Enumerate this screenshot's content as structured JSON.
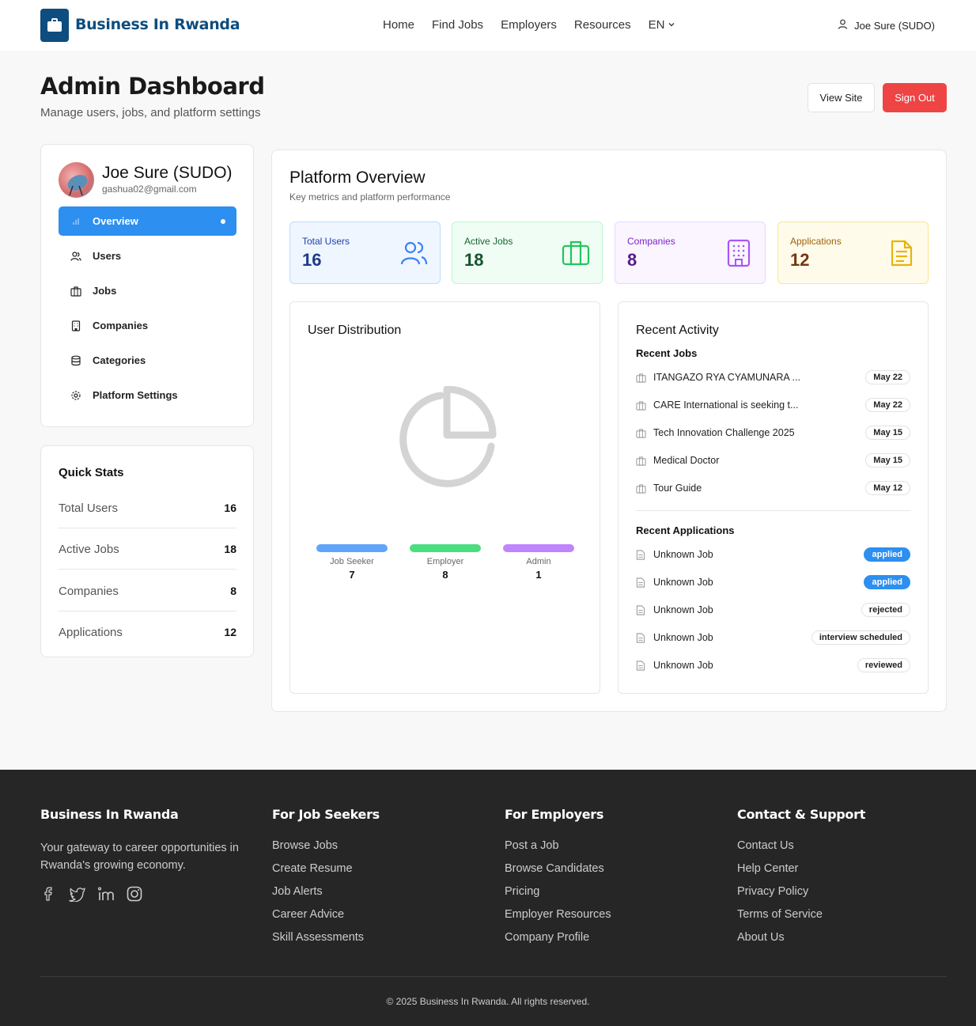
{
  "header": {
    "brand": "Business In Rwanda",
    "nav": [
      "Home",
      "Find Jobs",
      "Employers",
      "Resources"
    ],
    "language": "EN",
    "user": "Joe Sure (SUDO)"
  },
  "page": {
    "title": "Admin Dashboard",
    "subtitle": "Manage users, jobs, and platform settings",
    "view_site": "View Site",
    "sign_out": "Sign Out"
  },
  "profile": {
    "name": "Joe Sure (SUDO)",
    "email": "gashua02@gmail.com"
  },
  "menu": [
    {
      "label": "Overview",
      "icon": "bar-chart-icon",
      "active": true
    },
    {
      "label": "Users",
      "icon": "users-icon"
    },
    {
      "label": "Jobs",
      "icon": "briefcase-icon"
    },
    {
      "label": "Companies",
      "icon": "building-icon"
    },
    {
      "label": "Categories",
      "icon": "database-icon"
    },
    {
      "label": "Platform Settings",
      "icon": "gear-icon"
    }
  ],
  "quick_stats": {
    "title": "Quick Stats",
    "rows": [
      {
        "label": "Total Users",
        "value": "16"
      },
      {
        "label": "Active Jobs",
        "value": "18"
      },
      {
        "label": "Companies",
        "value": "8"
      },
      {
        "label": "Applications",
        "value": "12"
      }
    ]
  },
  "overview": {
    "title": "Platform Overview",
    "subtitle": "Key metrics and platform performance",
    "stats": [
      {
        "label": "Total Users",
        "value": "16",
        "icon": "users-icon",
        "color": "#1e40af"
      },
      {
        "label": "Active Jobs",
        "value": "18",
        "icon": "briefcase-icon",
        "color": "#166534"
      },
      {
        "label": "Companies",
        "value": "8",
        "icon": "building-icon",
        "color": "#6b21a8"
      },
      {
        "label": "Applications",
        "value": "12",
        "icon": "document-icon",
        "color": "#92400e"
      }
    ]
  },
  "distribution": {
    "title": "User Distribution",
    "legend": [
      {
        "name": "Job Seeker",
        "value": "7",
        "color": "#60a5fa"
      },
      {
        "name": "Employer",
        "value": "8",
        "color": "#4ade80"
      },
      {
        "name": "Admin",
        "value": "1",
        "color": "#c084fc"
      }
    ]
  },
  "activity": {
    "title": "Recent Activity",
    "jobs_title": "Recent Jobs",
    "jobs": [
      {
        "title": "ITANGAZO RYA CYAMUNARA ...",
        "date": "May 22"
      },
      {
        "title": "CARE International is seeking t...",
        "date": "May 22"
      },
      {
        "title": "Tech Innovation Challenge 2025",
        "date": "May 15"
      },
      {
        "title": "Medical Doctor",
        "date": "May 15"
      },
      {
        "title": "Tour Guide",
        "date": "May 12"
      }
    ],
    "apps_title": "Recent Applications",
    "applications": [
      {
        "title": "Unknown Job",
        "status": "applied"
      },
      {
        "title": "Unknown Job",
        "status": "applied"
      },
      {
        "title": "Unknown Job",
        "status": "rejected"
      },
      {
        "title": "Unknown Job",
        "status": "interview scheduled"
      },
      {
        "title": "Unknown Job",
        "status": "reviewed"
      }
    ]
  },
  "footer": {
    "brand": "Business In Rwanda",
    "description": "Your gateway to career opportunities in Rwanda's growing economy.",
    "columns": [
      {
        "title": "For Job Seekers",
        "links": [
          "Browse Jobs",
          "Create Resume",
          "Job Alerts",
          "Career Advice",
          "Skill Assessments"
        ]
      },
      {
        "title": "For Employers",
        "links": [
          "Post a Job",
          "Browse Candidates",
          "Pricing",
          "Employer Resources",
          "Company Profile"
        ]
      },
      {
        "title": "Contact & Support",
        "links": [
          "Contact Us",
          "Help Center",
          "Privacy Policy",
          "Terms of Service",
          "About Us"
        ]
      }
    ],
    "social": [
      "facebook-icon",
      "twitter-icon",
      "linkedin-icon",
      "instagram-icon"
    ],
    "copyright": "© 2025 Business In Rwanda. All rights reserved."
  }
}
